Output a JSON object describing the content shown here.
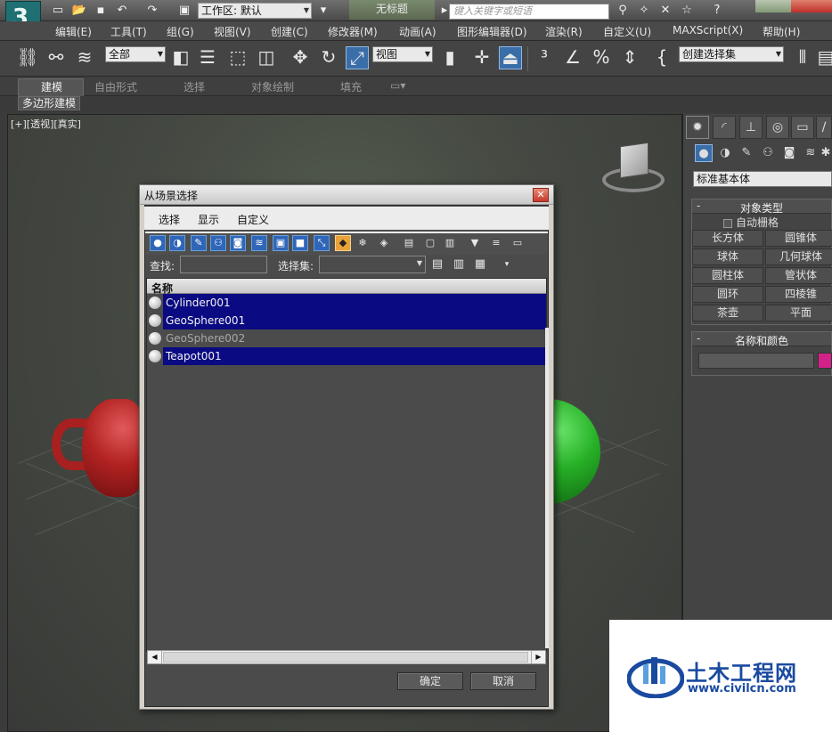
{
  "titlebar": {
    "workspace": "工作区: 默认",
    "doc_title": "无标题",
    "search_placeholder": "键入关键字或短语"
  },
  "menubar": {
    "items": [
      "编辑(E)",
      "工具(T)",
      "组(G)",
      "视图(V)",
      "创建(C)",
      "修改器(M)",
      "动画(A)",
      "图形编辑器(D)",
      "渲染(R)",
      "自定义(U)",
      "MAXScript(X)",
      "帮助(H)"
    ]
  },
  "toolbar": {
    "filter_value": "全部",
    "ref_coord_value": "视图",
    "named_sel_placeholder": "创建选择集"
  },
  "ribbon": {
    "tabs": [
      "建模",
      "自由形式",
      "选择",
      "对象绘制",
      "填充"
    ],
    "active_tab": "建模",
    "sub_label": "多边形建模"
  },
  "viewport": {
    "label": "[+][透视][真实]"
  },
  "command_panel": {
    "category": "标准基本体",
    "object_type_title": "对象类型",
    "autogrid_label": "自动栅格",
    "object_buttons": [
      "长方体",
      "圆锥体",
      "球体",
      "几何球体",
      "圆柱体",
      "管状体",
      "圆环",
      "四棱锥",
      "茶壶",
      "平面"
    ],
    "name_color_title": "名称和颜色",
    "object_color": "#d4218a"
  },
  "dialog": {
    "title": "从场景选择",
    "close_glyph": "✕",
    "menus": [
      "选择",
      "显示",
      "自定义"
    ],
    "find_label": "查找:",
    "selection_set_label": "选择集:",
    "column_header": "名称",
    "rows": [
      {
        "name": "Cylinder001",
        "selected": true
      },
      {
        "name": "GeoSphere001",
        "selected": true
      },
      {
        "name": "GeoSphere002",
        "selected": false
      },
      {
        "name": "Teapot001",
        "selected": true
      }
    ],
    "ok_label": "确定",
    "cancel_label": "取消",
    "selection_color": "#0a0a82"
  },
  "watermark": {
    "title": "土木工程网",
    "url": "www.civilcn.com"
  }
}
